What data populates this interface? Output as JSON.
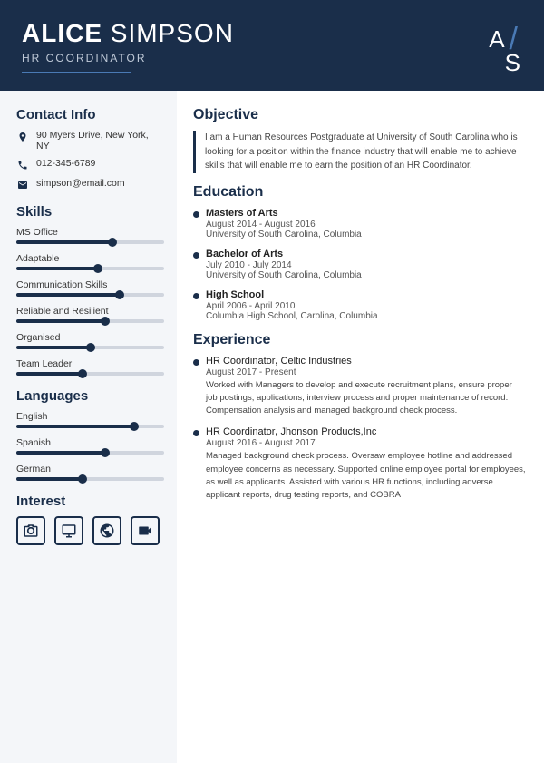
{
  "header": {
    "first_name": "ALICE",
    "last_name": "SIMPSON",
    "title": "HR COORDINATOR",
    "initial_a": "A",
    "initial_s": "S",
    "slash": "/"
  },
  "contact": {
    "section_title": "Contact Info",
    "address": "90 Myers Drive, New York, NY",
    "phone": "012-345-6789",
    "email": "simpson@email.com"
  },
  "skills": {
    "section_title": "Skills",
    "items": [
      {
        "label": "MS Office",
        "fill": 65,
        "dot": 65
      },
      {
        "label": "Adaptable",
        "fill": 55,
        "dot": 55
      },
      {
        "label": "Communication Skills",
        "fill": 70,
        "dot": 70
      },
      {
        "label": "Reliable and Resilient",
        "fill": 60,
        "dot": 60
      },
      {
        "label": "Organised",
        "fill": 50,
        "dot": 50
      },
      {
        "label": "Team Leader",
        "fill": 45,
        "dot": 45
      }
    ]
  },
  "languages": {
    "section_title": "Languages",
    "items": [
      {
        "label": "English",
        "fill": 80,
        "dot": 80
      },
      {
        "label": "Spanish",
        "fill": 60,
        "dot": 60
      },
      {
        "label": "German",
        "fill": 45,
        "dot": 45
      }
    ]
  },
  "interest": {
    "section_title": "Interest",
    "icons": [
      "📷",
      "🖥",
      "🌐",
      "🎬"
    ]
  },
  "objective": {
    "section_title": "Objective",
    "text": "I am a Human Resources Postgraduate at University of South Carolina who is looking for a position within the finance industry that will enable me to achieve skills that will enable me to earn the position of an HR Coordinator."
  },
  "education": {
    "section_title": "Education",
    "items": [
      {
        "degree": "Masters of Arts",
        "date": "August 2014 - August 2016",
        "school": "University of South Carolina, Columbia"
      },
      {
        "degree": "Bachelor of Arts",
        "date": "July 2010 - July 2014",
        "school": "University of South Carolina, Columbia"
      },
      {
        "degree": "High School",
        "date": "April 2006 - April 2010",
        "school": "Columbia High School, Carolina, Columbia"
      }
    ]
  },
  "experience": {
    "section_title": "Experience",
    "items": [
      {
        "title": "HR Coordinator",
        "company": "Celtic Industries",
        "date": "August 2017 - Present",
        "description": "Worked with Managers to develop and execute recruitment plans, ensure proper job postings, applications, interview process and proper maintenance of record. Compensation analysis and managed background check process."
      },
      {
        "title": "HR Coordinator",
        "company": "Jhonson Products,Inc",
        "date": "August 2016 - August 2017",
        "description": "Managed background check process. Oversaw employee hotline and addressed employee concerns as necessary. Supported online employee portal for employees, as well as applicants. Assisted with various HR functions, including adverse applicant reports, drug testing reports, and COBRA"
      }
    ]
  }
}
